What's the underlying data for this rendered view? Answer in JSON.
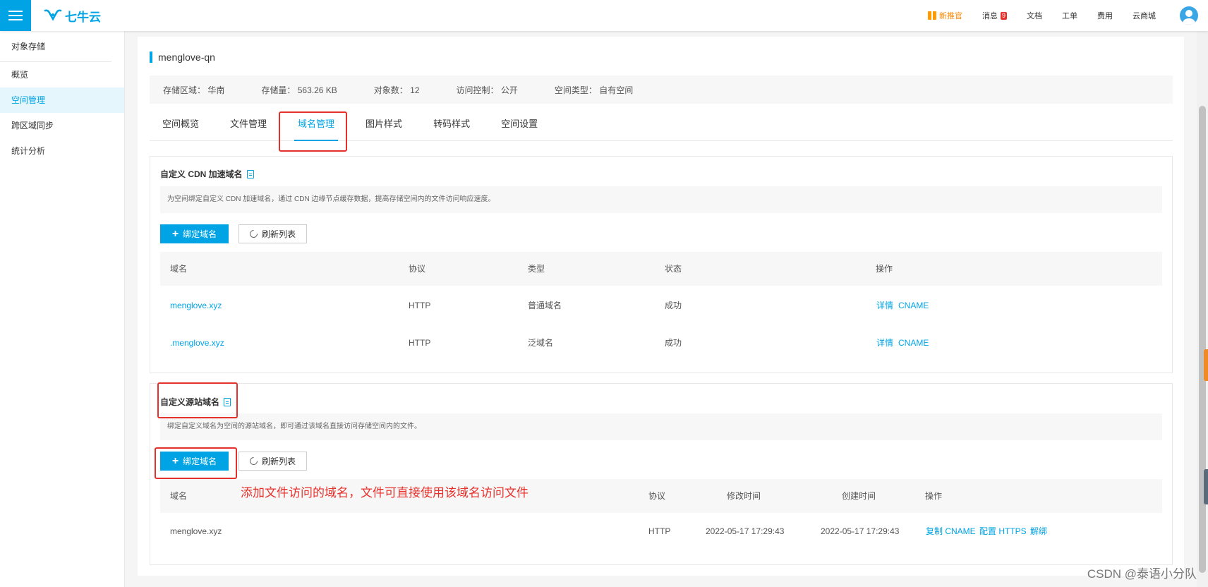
{
  "brand": {
    "logo_text": "七牛云",
    "accent": "#00a4e4"
  },
  "topnav": {
    "new": "新推官",
    "messages": "消息",
    "message_count": "9",
    "docs": "文档",
    "tickets": "工单",
    "billing": "费用",
    "mall": "云商城"
  },
  "sidebar": {
    "header": "对象存储",
    "items": [
      {
        "label": "概览"
      },
      {
        "label": "空间管理"
      },
      {
        "label": "跨区域同步"
      },
      {
        "label": "统计分析"
      }
    ]
  },
  "bucket": {
    "name": "menglove-qn",
    "info": [
      {
        "label": "存储区域：",
        "value": "华南"
      },
      {
        "label": "存储量：",
        "value": "563.26 KB"
      },
      {
        "label": "对象数：",
        "value": "12"
      },
      {
        "label": "访问控制：",
        "value": "公开"
      },
      {
        "label": "空间类型：",
        "value": "自有空间"
      }
    ]
  },
  "tabs": [
    {
      "label": "空间概览"
    },
    {
      "label": "文件管理"
    },
    {
      "label": "域名管理"
    },
    {
      "label": "图片样式"
    },
    {
      "label": "转码样式"
    },
    {
      "label": "空间设置"
    }
  ],
  "cdn": {
    "title": "自定义 CDN 加速域名",
    "desc": "为空间绑定自定义 CDN 加速域名，通过 CDN 边缘节点缓存数据，提高存储空间内的文件访问响应速度。",
    "bind_label": "绑定域名",
    "refresh_label": "刷新列表",
    "columns": [
      "域名",
      "协议",
      "类型",
      "状态",
      "操作"
    ],
    "rows": [
      {
        "domain": "menglove.xyz",
        "protocol": "HTTP",
        "type": "普通域名",
        "status": "成功",
        "action1": "详情",
        "action2": "CNAME"
      },
      {
        "domain": ".menglove.xyz",
        "protocol": "HTTP",
        "type": "泛域名",
        "status": "成功",
        "action1": "详情",
        "action2": "CNAME"
      }
    ]
  },
  "origin": {
    "title": "自定义源站域名",
    "desc": "绑定自定义域名为空间的源站域名，即可通过该域名直接访问存储空间内的文件。",
    "bind_label": "绑定域名",
    "refresh_label": "刷新列表",
    "columns": [
      "域名",
      "协议",
      "修改时间",
      "创建时间",
      "操作"
    ],
    "rows": [
      {
        "domain": "menglove.xyz",
        "protocol": "HTTP",
        "modified": "2022-05-17 17:29:43",
        "created": "2022-05-17 17:29:43",
        "action1": "复制 CNAME",
        "action2": "配置 HTTPS",
        "action3": "解绑"
      }
    ]
  },
  "annotation": "添加文件访问的域名，文件可直接使用该域名访问文件",
  "watermark": "CSDN @泰语小分队"
}
